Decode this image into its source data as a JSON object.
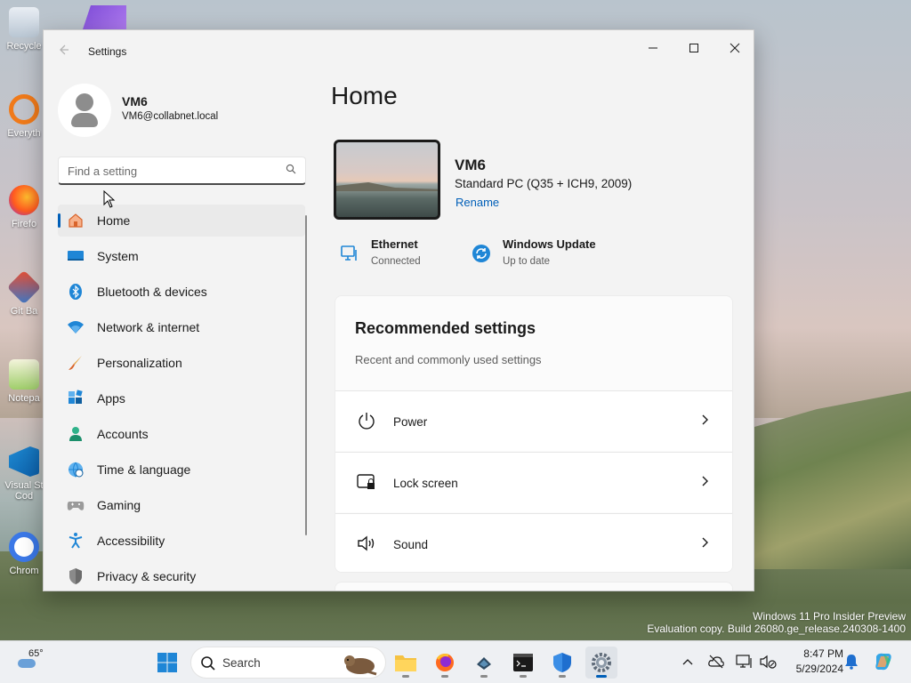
{
  "desktop": {
    "icons": [
      "Recycle",
      "Everyth",
      "Firefo",
      "Git Ba",
      "Notepa",
      "Visual St\nCod",
      "Chrom"
    ],
    "watermark_line1": "Windows 11 Pro Insider Preview",
    "watermark_line2": "Evaluation copy. Build 26080.ge_release.240308-1400"
  },
  "window": {
    "title": "Settings",
    "controls": {
      "minimize": "—",
      "maximize": "☐",
      "close": "✕"
    }
  },
  "user": {
    "name": "VM6",
    "email": "VM6@collabnet.local"
  },
  "search": {
    "placeholder": "Find a setting"
  },
  "nav": {
    "items": [
      {
        "label": "Home",
        "icon": "home-icon",
        "active": true
      },
      {
        "label": "System",
        "icon": "system-icon"
      },
      {
        "label": "Bluetooth & devices",
        "icon": "bluetooth-icon"
      },
      {
        "label": "Network & internet",
        "icon": "wifi-icon"
      },
      {
        "label": "Personalization",
        "icon": "brush-icon"
      },
      {
        "label": "Apps",
        "icon": "apps-icon"
      },
      {
        "label": "Accounts",
        "icon": "accounts-icon"
      },
      {
        "label": "Time & language",
        "icon": "globe-clock-icon"
      },
      {
        "label": "Gaming",
        "icon": "gamepad-icon"
      },
      {
        "label": "Accessibility",
        "icon": "accessibility-icon"
      },
      {
        "label": "Privacy & security",
        "icon": "shield-icon"
      }
    ]
  },
  "main": {
    "title": "Home",
    "pc": {
      "name": "VM6",
      "spec": "Standard PC (Q35 + ICH9, 2009)",
      "rename": "Rename"
    },
    "ethernet": {
      "title": "Ethernet",
      "status": "Connected"
    },
    "windows_update": {
      "title": "Windows Update",
      "status": "Up to date"
    },
    "recommended": {
      "title": "Recommended settings",
      "subtitle": "Recent and commonly used settings",
      "items": [
        {
          "label": "Power",
          "icon": "power-icon"
        },
        {
          "label": "Lock screen",
          "icon": "lock-screen-icon"
        },
        {
          "label": "Sound",
          "icon": "speaker-icon"
        }
      ]
    }
  },
  "taskbar": {
    "weather_temp": "65°",
    "search_label": "Search",
    "time": "8:47 PM",
    "date": "5/29/2024"
  },
  "colors": {
    "accent": "#005fb8",
    "window_bg": "#f3f3f3",
    "card_bg": "#fbfbfb"
  }
}
